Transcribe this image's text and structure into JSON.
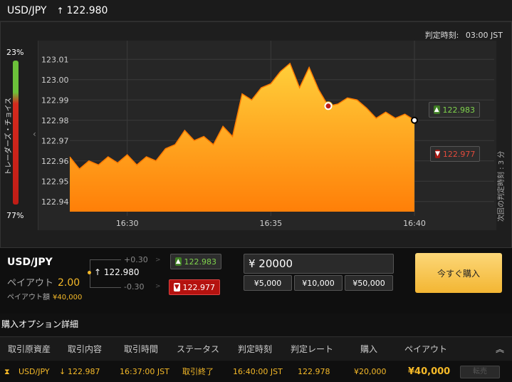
{
  "header": {
    "symbol": "USD/JPY",
    "arrow": "↑",
    "price": "122.980"
  },
  "chart_panel": {
    "judge_time_label": "判定時刻:",
    "judge_time_value": "03:00 JST",
    "gauge_top": "23%",
    "gauge_bottom": "77%",
    "gauge_label": "トレーダーズ・チョイス",
    "next_judge_label": "次回の判定時刻 : 3 分",
    "collapse_icon": "chevron-left-icon"
  },
  "chart_data": {
    "type": "area",
    "title": "",
    "xlabel": "",
    "ylabel": "",
    "x_ticks": [
      "16:30",
      "16:35",
      "16:40"
    ],
    "y_ticks": [
      "123.01",
      "123.00",
      "122.99",
      "122.98",
      "122.97",
      "122.96",
      "122.95",
      "122.94"
    ],
    "ylim": [
      122.935,
      123.015
    ],
    "xlim": [
      "16:28",
      "16:40"
    ],
    "grid": true,
    "series": [
      {
        "values": [
          [
            "16:28:00",
            122.962
          ],
          [
            "16:28:20",
            122.956
          ],
          [
            "16:28:40",
            122.96
          ],
          [
            "16:29:00",
            122.958
          ],
          [
            "16:29:20",
            122.962
          ],
          [
            "16:29:40",
            122.959
          ],
          [
            "16:30:00",
            122.963
          ],
          [
            "16:30:20",
            122.958
          ],
          [
            "16:30:40",
            122.962
          ],
          [
            "16:31:00",
            122.96
          ],
          [
            "16:31:20",
            122.966
          ],
          [
            "16:31:40",
            122.968
          ],
          [
            "16:32:00",
            122.975
          ],
          [
            "16:32:20",
            122.97
          ],
          [
            "16:32:40",
            122.972
          ],
          [
            "16:33:00",
            122.968
          ],
          [
            "16:33:20",
            122.977
          ],
          [
            "16:33:40",
            122.972
          ],
          [
            "16:34:00",
            122.993
          ],
          [
            "16:34:20",
            122.99
          ],
          [
            "16:34:40",
            122.996
          ],
          [
            "16:35:00",
            122.998
          ],
          [
            "16:35:20",
            123.004
          ],
          [
            "16:35:40",
            123.008
          ],
          [
            "16:36:00",
            122.996
          ],
          [
            "16:36:20",
            123.006
          ],
          [
            "16:36:40",
            122.995
          ],
          [
            "16:37:00",
            122.987
          ],
          [
            "16:37:20",
            122.988
          ],
          [
            "16:37:40",
            122.991
          ],
          [
            "16:38:00",
            122.99
          ],
          [
            "16:38:20",
            122.986
          ],
          [
            "16:38:40",
            122.981
          ],
          [
            "16:39:00",
            122.984
          ],
          [
            "16:39:20",
            122.981
          ],
          [
            "16:39:40",
            122.983
          ],
          [
            "16:40:00",
            122.98
          ]
        ]
      }
    ],
    "entry_marker": {
      "time": "16:37:00",
      "rate": 122.987
    },
    "high_price": "122.983",
    "low_price": "122.977"
  },
  "trade": {
    "symbol": "USD/JPY",
    "payout_label": "ペイアウト",
    "payout_value": "2.00",
    "payout_amount_label": "ペイアウト額",
    "payout_amount": "¥40,000",
    "plus": "+0.30",
    "minus": "-0.30",
    "current_arrow": "↑",
    "current_price": "122.980",
    "up_price": "122.983",
    "down_price": "122.977",
    "amount": "¥ 20000",
    "presets": [
      "¥5,000",
      "¥10,000",
      "¥50,000"
    ],
    "buy_now": "今すぐ購入"
  },
  "details": {
    "title": "購入オプション詳細",
    "headers": [
      "取引原資産",
      "取引内容",
      "取引時間",
      "ステータス",
      "判定時刻",
      "判定レート",
      "購入",
      "ペイアウト"
    ],
    "row": {
      "asset": "USD/JPY",
      "direction_arrow": "↓",
      "content": "122.987",
      "time": "16:37:00 JST",
      "status": "取引終了",
      "judge_time": "16:40:00 JST",
      "judge_rate": "122.978",
      "purchase": "¥20,000",
      "payout": "¥40,000",
      "sell_label": "転売"
    }
  }
}
